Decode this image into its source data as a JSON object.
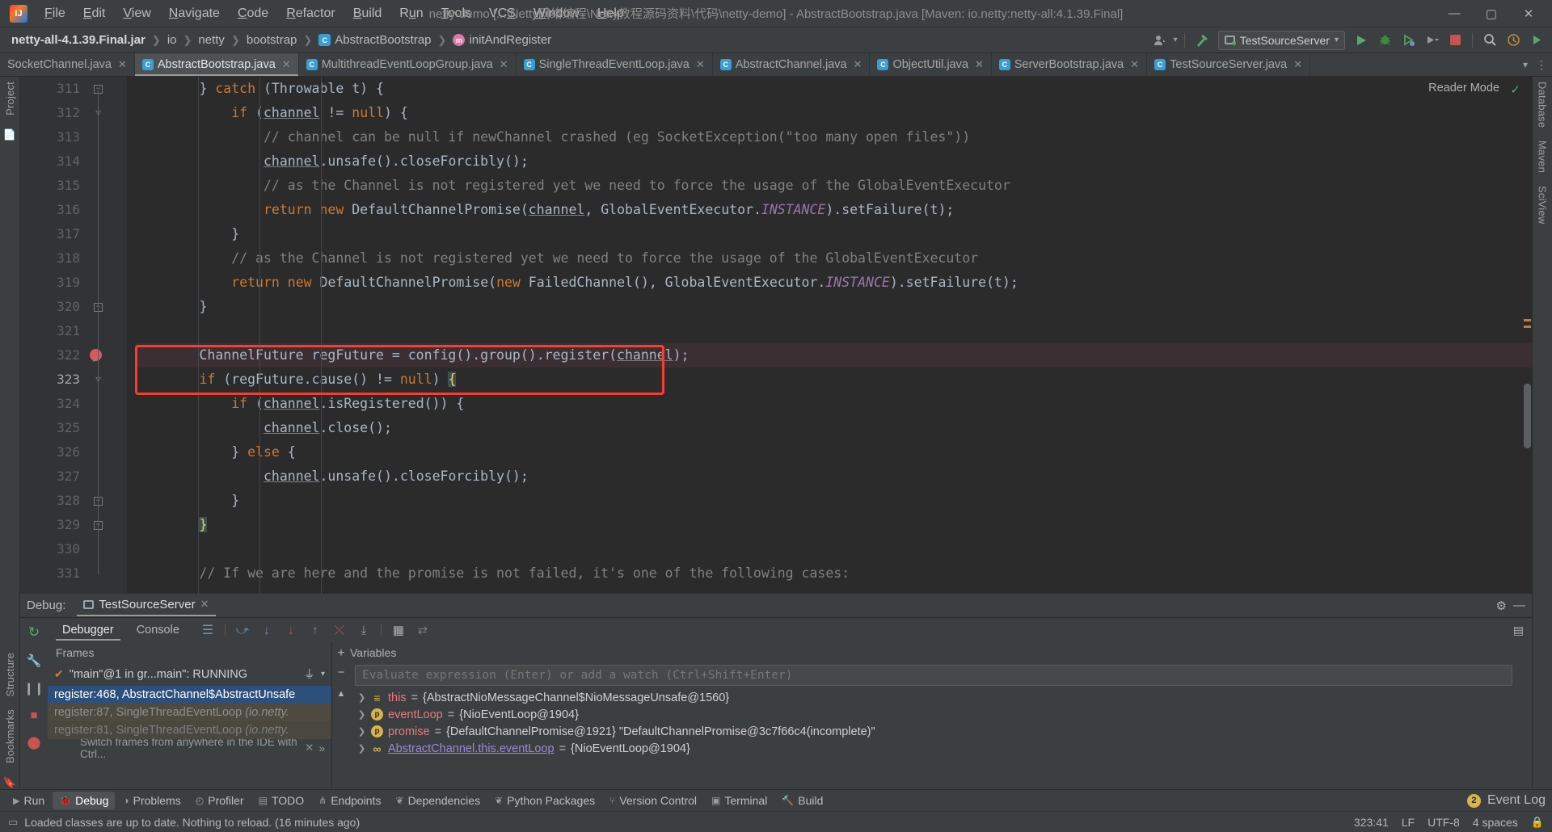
{
  "window": {
    "title": "netty-demo [...\\Netty网络编程\\Netty教程源码资料\\代码\\netty-demo] - AbstractBootstrap.java [Maven: io.netty:netty-all:4.1.39.Final]",
    "minimize": "—",
    "maximize": "▢",
    "close": "✕"
  },
  "menu": {
    "items": [
      {
        "label": "File"
      },
      {
        "label": "Edit"
      },
      {
        "label": "View"
      },
      {
        "label": "Navigate"
      },
      {
        "label": "Code"
      },
      {
        "label": "Refactor"
      },
      {
        "label": "Build"
      },
      {
        "label": "Run"
      },
      {
        "label": "Tools"
      },
      {
        "label": "VCS"
      },
      {
        "label": "Window"
      },
      {
        "label": "Help"
      }
    ]
  },
  "navbar": {
    "crumbs": [
      {
        "label": "netty-all-4.1.39.Final.jar",
        "icon": "",
        "bold": true
      },
      {
        "label": "io",
        "icon": ""
      },
      {
        "label": "netty",
        "icon": ""
      },
      {
        "label": "bootstrap",
        "icon": ""
      },
      {
        "label": "AbstractBootstrap",
        "icon": "C"
      },
      {
        "label": "initAndRegister",
        "icon": "m"
      }
    ],
    "separator": "❯",
    "run_config": "TestSourceServer",
    "icons": {
      "user": "user-icon",
      "hammer": "build-hammer-icon",
      "run": "run-icon",
      "debug": "debug-icon",
      "coverage": "coverage-icon",
      "more": "more-icon",
      "stop": "stop-icon",
      "search": "search-icon",
      "updates": "updates-icon",
      "play_right": "play-right-icon"
    }
  },
  "editor_tabs": [
    {
      "label": "SocketChannel.java",
      "icon": "",
      "active": false
    },
    {
      "label": "AbstractBootstrap.java",
      "icon": "C",
      "active": true
    },
    {
      "label": "MultithreadEventLoopGroup.java",
      "icon": "C",
      "active": false
    },
    {
      "label": "SingleThreadEventLoop.java",
      "icon": "C",
      "active": false
    },
    {
      "label": "AbstractChannel.java",
      "icon": "C",
      "active": false
    },
    {
      "label": "ObjectUtil.java",
      "icon": "C",
      "active": false
    },
    {
      "label": "ServerBootstrap.java",
      "icon": "C",
      "active": false
    },
    {
      "label": "TestSourceServer.java",
      "icon": "C",
      "active": false
    }
  ],
  "editor": {
    "reader_mode": "Reader Mode",
    "reader_check": "✓",
    "lines": [
      {
        "n": "311",
        "fold": "−",
        "html": "        } <kw>catch</kw> (Throwable t) {"
      },
      {
        "n": "312",
        "fold": "▽",
        "html": "            <kw>if</kw> (<un>channel</un> != <kw>null</kw>) {"
      },
      {
        "n": "313",
        "fold": "",
        "html": "                <cm>// channel can be null if newChannel crashed (eg SocketException(\"too many open files\"))</cm>"
      },
      {
        "n": "314",
        "fold": "",
        "html": "                <un>channel</un>.unsafe().closeForcibly();"
      },
      {
        "n": "315",
        "fold": "",
        "html": "                <cm>// as the Channel is not registered yet we need to force the usage of the GlobalEventExecutor</cm>"
      },
      {
        "n": "316",
        "fold": "",
        "html": "                <kw>return</kw> <kw>new</kw> DefaultChannelPromise(<un>channel</un>, GlobalEventExecutor.<itl>INSTANCE</itl>).setFailure(t);"
      },
      {
        "n": "317",
        "fold": "",
        "html": "            }"
      },
      {
        "n": "318",
        "fold": "",
        "html": "            <cm>// as the Channel is not registered yet we need to force the usage of the GlobalEventExecutor</cm>"
      },
      {
        "n": "319",
        "fold": "",
        "html": "            <kw>return</kw> <kw>new</kw> DefaultChannelPromise(<kw>new</kw> FailedChannel(), GlobalEventExecutor.<itl>INSTANCE</itl>).setFailure(t);"
      },
      {
        "n": "320",
        "fold": "−",
        "html": "        }"
      },
      {
        "n": "321",
        "fold": "",
        "html": ""
      },
      {
        "n": "322",
        "fold": "",
        "breakpoint": true,
        "exec": true,
        "html": "        ChannelFuture regFuture = config().group().register(<un>channel</un>);"
      },
      {
        "n": "323",
        "fold": "▽",
        "current": true,
        "html": "        <kw>if</kw> (regFuture.cause() != <kw>null</kw>) <brace>{</brace>"
      },
      {
        "n": "324",
        "fold": "",
        "html": "            <kw>if</kw> (<un>channel</un>.isRegistered()) {"
      },
      {
        "n": "325",
        "fold": "",
        "html": "                <un>channel</un>.close();"
      },
      {
        "n": "326",
        "fold": "",
        "html": "            } <kw>else</kw> {"
      },
      {
        "n": "327",
        "fold": "",
        "html": "                <un>channel</un>.unsafe().closeForcibly();"
      },
      {
        "n": "328",
        "fold": "−",
        "html": "            }"
      },
      {
        "n": "329",
        "fold": "−",
        "html": "        <brace>}</brace>"
      },
      {
        "n": "330",
        "fold": "",
        "html": ""
      },
      {
        "n": "331",
        "fold": "",
        "html": "        <cm>// If we are here and the promise is not failed, it's one of the following cases:</cm>"
      }
    ]
  },
  "debug": {
    "label": "Debug:",
    "session": "TestSourceServer",
    "close": "✕",
    "settings_icon": "gear-icon",
    "minimize_icon": "minimize-icon",
    "tabs": [
      {
        "label": "Debugger",
        "active": true
      },
      {
        "label": "Console",
        "active": false
      }
    ],
    "toolbar_icons": [
      "layout-icon",
      "step-over-icon",
      "step-into-icon",
      "force-step-into-icon",
      "step-out-icon",
      "drop-frame-icon",
      "run-to-cursor-icon",
      "evaluate-icon",
      "sort-icon"
    ],
    "left_icons": [
      "rerun-icon",
      "wrench-icon",
      "pause-icon",
      "stop-icon",
      "mute-breakpoints-icon"
    ],
    "frames": {
      "title": "Frames",
      "thread": "\"main\"@1 in gr...main\": RUNNING",
      "filter_icon": "filter-icon",
      "dropdown_icon": "chevron-down-icon",
      "items": [
        {
          "label": "register:468, AbstractChannel$AbstractUnsafe",
          "selected": true,
          "pkg": ""
        },
        {
          "label": "register:87, SingleThreadEventLoop ",
          "pkg": "(io.netty.",
          "dim": true
        },
        {
          "label": "register:81, SingleThreadEventLoop ",
          "pkg": "(io.netty.",
          "dim": true
        }
      ],
      "hint": "Switch frames from anywhere in the IDE with Ctrl...",
      "hint_close": "✕"
    },
    "variables": {
      "title": "Variables",
      "watch_placeholder": "Evaluate expression (Enter) or add a watch (Ctrl+Shift+Enter)",
      "add_icon": "+",
      "remove_icon": "−",
      "up_icon": "▲",
      "items": [
        {
          "chev": "❯",
          "badge": "t",
          "badge_text": "≡",
          "name": "this",
          "eq": " = ",
          "value": "{AbstractNioMessageChannel$NioMessageUnsafe@1560}",
          "link": false
        },
        {
          "chev": "❯",
          "badge": "p",
          "badge_text": "p",
          "name": "eventLoop",
          "eq": " = ",
          "value": "{NioEventLoop@1904}",
          "link": false
        },
        {
          "chev": "❯",
          "badge": "p",
          "badge_text": "p",
          "name": "promise",
          "eq": " = ",
          "value": "{DefaultChannelPromise@1921} \"DefaultChannelPromise@3c7f66c4(incomplete)\"",
          "link": false
        },
        {
          "chev": "❯",
          "badge": "t",
          "badge_text": "∞",
          "name": "AbstractChannel.this.eventLoop",
          "eq": " = ",
          "value": "{NioEventLoop@1904}",
          "link": true
        }
      ]
    }
  },
  "bottom_bar": {
    "buttons": [
      {
        "label": "Run",
        "icon": "run-icon",
        "active": false
      },
      {
        "label": "Debug",
        "icon": "debug-icon",
        "active": true
      },
      {
        "label": "Problems",
        "icon": "problems-icon",
        "active": false
      },
      {
        "label": "Profiler",
        "icon": "profiler-icon",
        "active": false
      },
      {
        "label": "TODO",
        "icon": "todo-icon",
        "active": false
      },
      {
        "label": "Endpoints",
        "icon": "endpoints-icon",
        "active": false
      },
      {
        "label": "Dependencies",
        "icon": "dependencies-icon",
        "active": false
      },
      {
        "label": "Python Packages",
        "icon": "python-icon",
        "active": false
      },
      {
        "label": "Version Control",
        "icon": "vcs-icon",
        "active": false
      },
      {
        "label": "Terminal",
        "icon": "terminal-icon",
        "active": false
      },
      {
        "label": "Build",
        "icon": "build-icon",
        "active": false
      }
    ],
    "event_log": "Event Log",
    "event_count": "2"
  },
  "statusbar": {
    "message": "Loaded classes are up to date. Nothing to reload. (16 minutes ago)",
    "caret": "323:41",
    "line_sep": "LF",
    "encoding": "UTF-8",
    "indent": "4 spaces",
    "lock_icon": "lock-icon"
  },
  "rails": {
    "left": [
      "Project",
      "Structure",
      "Bookmarks"
    ],
    "right": [
      "Database",
      "Maven",
      "SciView"
    ]
  },
  "colors": {
    "accent_red": "#ff3b30",
    "bg": "#3c3f41",
    "editor_bg": "#2b2b2b",
    "keyword": "#cc7832",
    "comment": "#808080",
    "selection": "#2d4f7c"
  }
}
